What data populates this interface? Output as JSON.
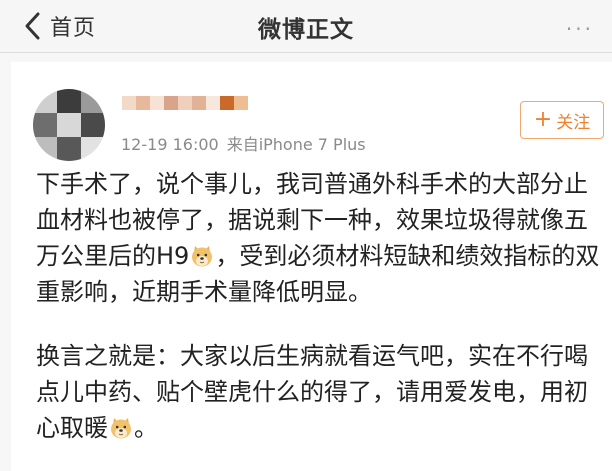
{
  "nav": {
    "back_label": "首页",
    "title": "微博正文",
    "more": "···"
  },
  "post": {
    "timestamp": "12-19 16:00",
    "source": "来自iPhone 7 Plus",
    "follow_label": "关注",
    "follow_icon": "+",
    "para1": {
      "part1": "下手术了，说个事儿，我司普通外科手术的大部分止血材料也被停了，据说剩下一种，效果垃圾得就像五万公里后的H9",
      "part2": "，受到必须材料短缺和绩效指标的双重影响，近期手术量降低明显。"
    },
    "para2": {
      "part1": "换言之就是：大家以后生病就看运气吧，实在不行喝点儿中药、贴个壁虎什么的得了，请用爱发电，用初心取暖",
      "part2": "。"
    }
  },
  "colors": {
    "accent": "#f08030",
    "meta_text": "#8a8a8a",
    "body_text": "#222222"
  },
  "icons": [
    "back-chevron-icon",
    "more-icon",
    "plus-icon",
    "doge-emoji-icon"
  ]
}
